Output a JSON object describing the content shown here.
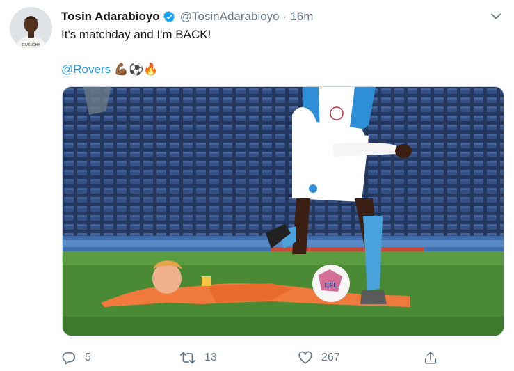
{
  "tweet": {
    "author_name": "Tosin Adarabioyo",
    "author_handle": "@TosinAdarabioyo",
    "separator": "·",
    "time": "16m",
    "text_line1": "It's matchday and I'm BACK!",
    "mention": "@Rovers",
    "emojis": "💪🏾⚽🔥",
    "avatar_shirt_text": "GIVENCHY"
  },
  "actions": {
    "replies": "5",
    "retweets": "13",
    "likes": "267"
  },
  "colors": {
    "link": "#1b95e0",
    "muted": "#657786",
    "verified": "#1da1f2"
  },
  "photo": {
    "ball_text": "EFL"
  }
}
